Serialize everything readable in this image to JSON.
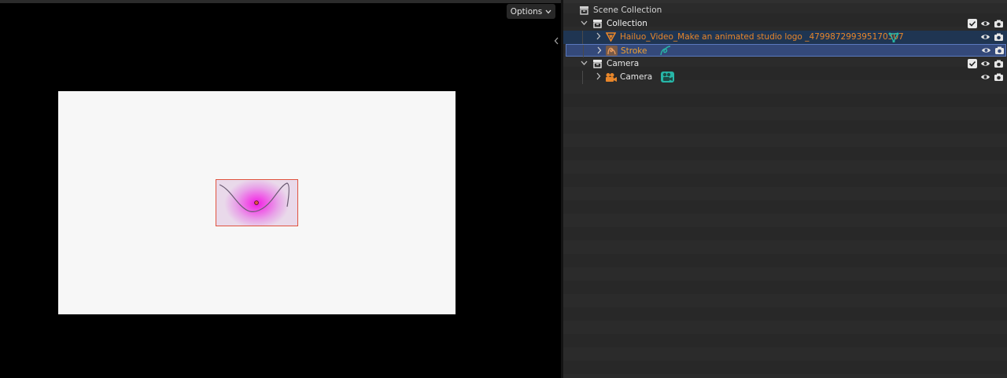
{
  "viewport": {
    "options_label": "Options",
    "options_chevron_icon": "chevron-down-icon",
    "collapse_icon": "chevron-left-icon",
    "stroke_color": "#e0533f",
    "frame_color": "#f7f7f7"
  },
  "outliner": {
    "scene_collection": {
      "label": "Scene Collection",
      "icon": "scene-collection-icon"
    },
    "items": [
      {
        "label": "Collection",
        "icon": "collection-icon",
        "expanded": true,
        "checkbox": true
      },
      {
        "label": "Hailuo_Video_Make an animated studio logo _479987299395170307",
        "icon": "object-icon",
        "data_icon": "vertex-group-icon",
        "selected": true,
        "active": false
      },
      {
        "label": "Stroke",
        "icon": "grease-pencil-icon",
        "data_icon": "stroke-data-icon",
        "selected": true,
        "active": true
      },
      {
        "label": "Camera",
        "icon": "collection-icon",
        "expanded": true,
        "checkbox": true
      },
      {
        "label": "Camera",
        "icon": "camera-object-icon",
        "data_icon": "camera-data-icon"
      }
    ],
    "colors": {
      "object_name": "#e8862a",
      "selection": "#1f3552",
      "active_selection": "#34497a",
      "data_icon_teal": "#27b6a7"
    }
  }
}
